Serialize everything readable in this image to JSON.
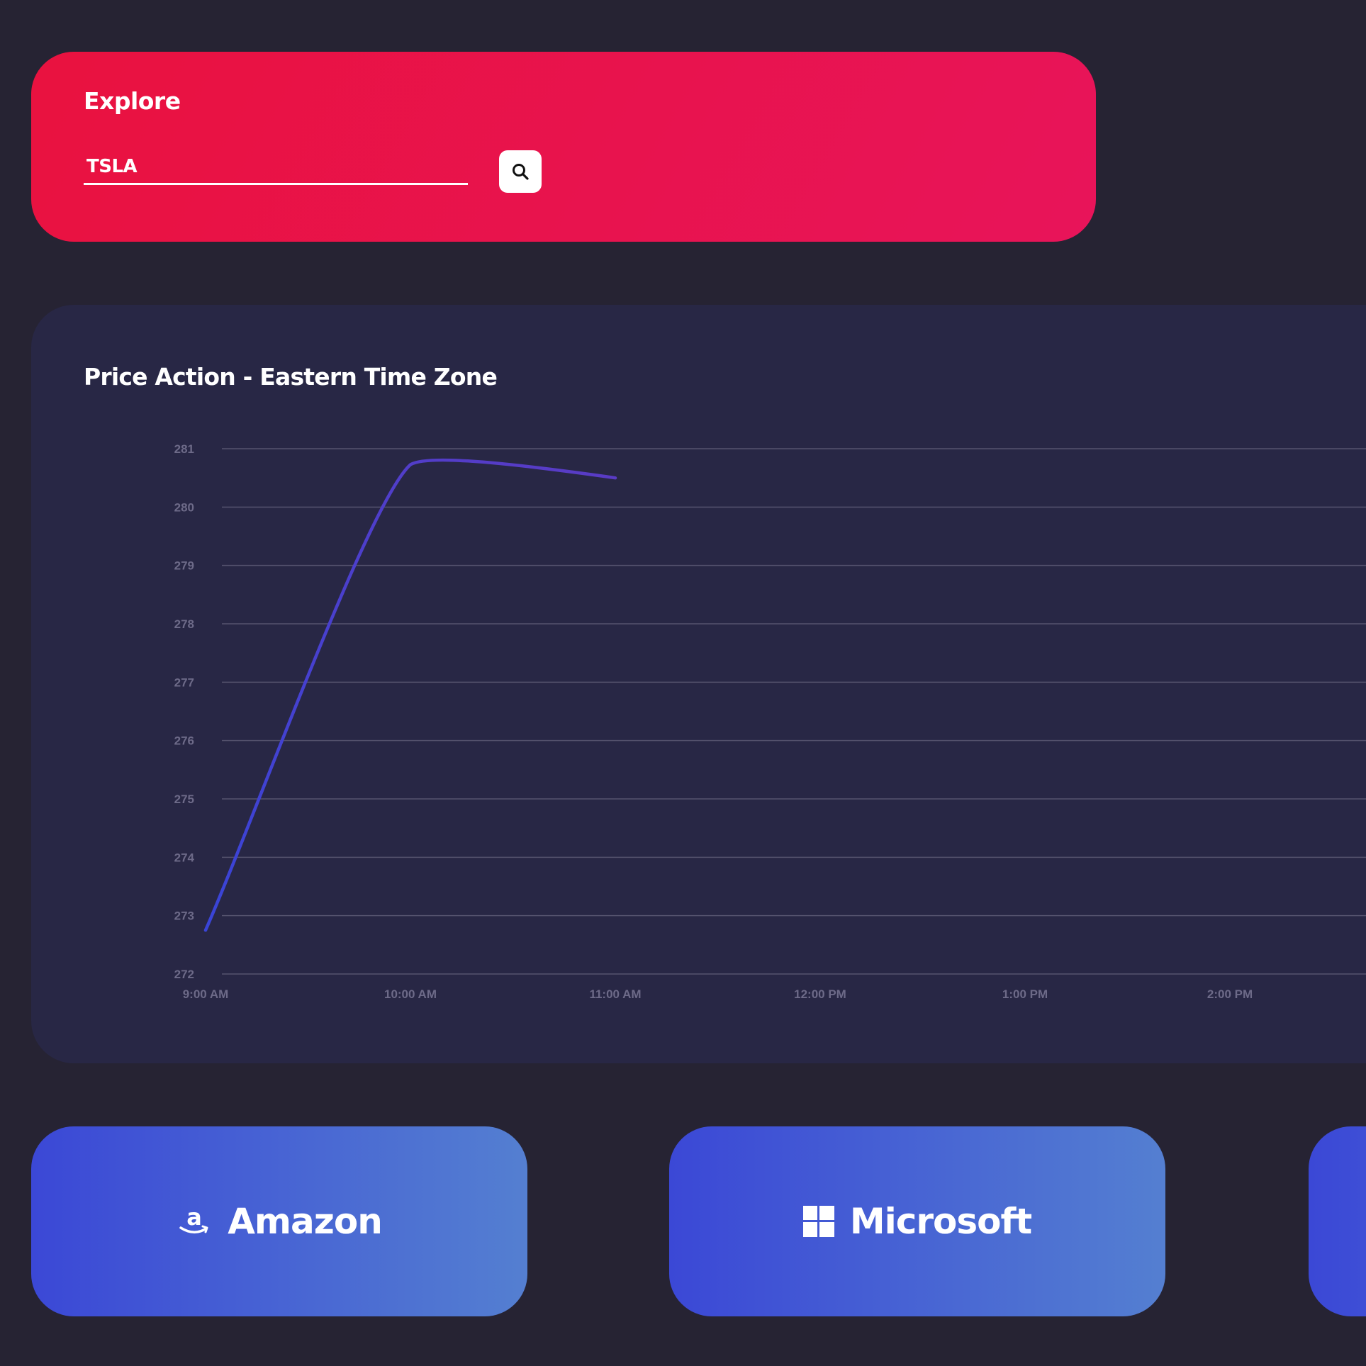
{
  "explore": {
    "title": "Explore",
    "search_value": "TSLA",
    "search_placeholder": "",
    "search_icon": "search-icon",
    "accent_color": "#e9123f"
  },
  "chart": {
    "title": "Price Action - Eastern Time Zone"
  },
  "chart_data": {
    "type": "line",
    "title": "Price Action - Eastern Time Zone",
    "xlabel": "",
    "ylabel": "",
    "x_tick_labels": [
      "9:00 AM",
      "10:00 AM",
      "11:00 AM",
      "12:00 PM",
      "1:00 PM",
      "2:00 PM"
    ],
    "y_tick_labels": [
      "272",
      "273",
      "274",
      "275",
      "276",
      "277",
      "278",
      "279",
      "280",
      "281"
    ],
    "ylim": [
      272,
      281
    ],
    "xlim_hours": [
      9,
      14
    ],
    "grid": true,
    "series": [
      {
        "color": "#4b3fd0",
        "x": [
          "9:00 AM",
          "10:00 AM",
          "11:00 AM"
        ],
        "x_hours": [
          9,
          10,
          11
        ],
        "values": [
          272.75,
          280.8,
          280.5
        ]
      }
    ]
  },
  "companies": [
    {
      "label": "Amazon",
      "icon": "amazon-icon"
    },
    {
      "label": "Microsoft",
      "icon": "windows-icon"
    },
    {
      "label": "",
      "icon": ""
    }
  ],
  "colors": {
    "background": "#262333",
    "chart_card": "#282745",
    "button_gradient_start": "#3b48d6",
    "button_gradient_end": "#547fd1"
  }
}
